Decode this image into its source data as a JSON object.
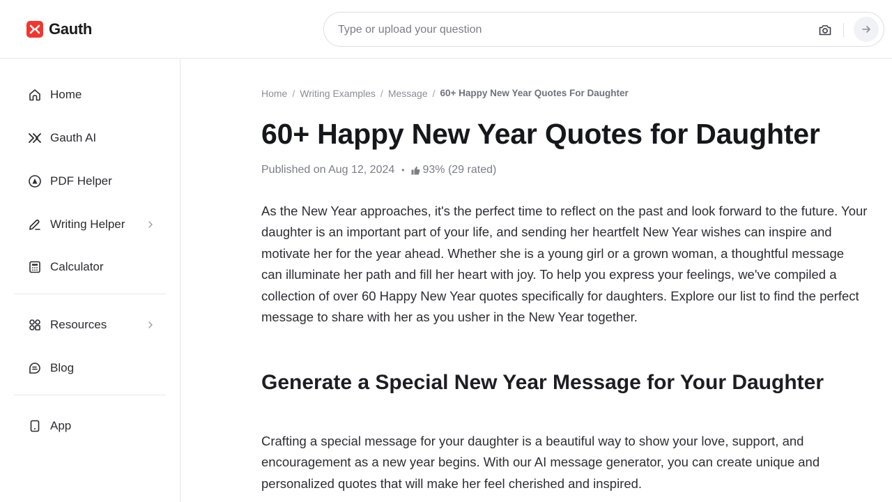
{
  "brand": {
    "name": "Gauth",
    "accent": "#f2362f"
  },
  "search": {
    "placeholder": "Type or upload your question",
    "icons": [
      "camera-icon",
      "arrow-right-icon"
    ]
  },
  "sidebar": {
    "items": [
      {
        "label": "Home",
        "icon": "home-icon"
      },
      {
        "label": "Gauth AI",
        "icon": "gauth-ai-icon"
      },
      {
        "label": "PDF Helper",
        "icon": "pdf-icon"
      },
      {
        "label": "Writing Helper",
        "icon": "pen-icon",
        "has_submenu": true
      },
      {
        "label": "Calculator",
        "icon": "calculator-icon"
      },
      {
        "label": "Resources",
        "icon": "grid-icon",
        "has_submenu": true
      },
      {
        "label": "Blog",
        "icon": "blog-icon"
      },
      {
        "label": "App",
        "icon": "phone-icon"
      }
    ]
  },
  "breadcrumb": {
    "home": "Home",
    "writing_examples": "Writing Examples",
    "message": "Message",
    "current": "60+ Happy New Year Quotes For Daughter",
    "separator": "/"
  },
  "article": {
    "title": "60+ Happy New Year Quotes for Daughter",
    "published": "Published on Aug 12, 2024",
    "rating": "93% (29 rated)",
    "intro": "As the New Year approaches, it's the perfect time to reflect on the past and look forward to the future. Your daughter is an important part of your life, and sending her heartfelt New Year wishes can inspire and motivate her for the year ahead. Whether she is a young girl or a grown woman, a thoughtful message can illuminate her path and fill her heart with joy. To help you express your feelings, we've compiled a collection of over 60 Happy New Year quotes specifically for daughters. Explore our list to find the perfect message to share with her as you usher in the New Year together.",
    "section_heading": "Generate a Special New Year Message for Your Daughter",
    "section_text": "Crafting a special message for your daughter is a beautiful way to show your love, support, and encouragement as a new year begins. With our AI message generator, you can create unique and personalized quotes that will make her feel cherished and inspired."
  }
}
